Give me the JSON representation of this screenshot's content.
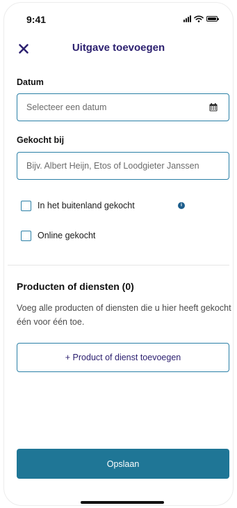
{
  "status_bar": {
    "time": "9:41"
  },
  "header": {
    "title": "Uitgave toevoegen",
    "close_icon": "close-icon"
  },
  "form": {
    "date": {
      "label": "Datum",
      "placeholder": "Selecteer een datum",
      "value": "",
      "icon": "calendar-icon"
    },
    "purchased_at": {
      "label": "Gekocht bij",
      "placeholder": "Bijv. Albert Heijn, Etos of Loodgieter Janssen",
      "value": ""
    },
    "checkboxes": [
      {
        "label": "In het buitenland gekocht",
        "checked": false,
        "info_icon": "info-icon"
      },
      {
        "label": "Online gekocht",
        "checked": false
      }
    ]
  },
  "products": {
    "title": "Producten of diensten (0)",
    "description": "Voeg alle producten of diensten die u hier heeft gekocht één voor één toe.",
    "add_button_label": "+ Product of dienst toevoegen"
  },
  "footer": {
    "save_label": "Opslaan"
  },
  "colors": {
    "title": "#2d2170",
    "border": "#2a7fa6",
    "primary_button": "#1f7696",
    "info_icon": "#1d5e8c"
  }
}
